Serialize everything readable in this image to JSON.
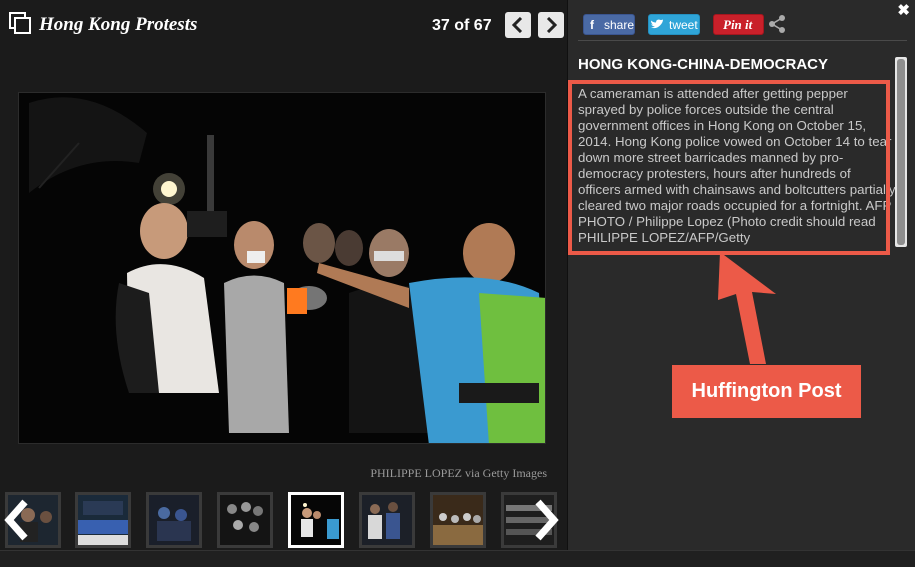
{
  "gallery": {
    "title": "Hong Kong Protests",
    "counter_text": "37 of 67",
    "current": 37,
    "total": 67,
    "photo_credit": "PHILIPPE LOPEZ via Getty Images",
    "prev_icon": "chevron-left-icon",
    "next_icon": "chevron-right-icon",
    "thumbnails": [
      {
        "alt": "thumbnail-1"
      },
      {
        "alt": "thumbnail-2"
      },
      {
        "alt": "thumbnail-3"
      },
      {
        "alt": "thumbnail-4"
      },
      {
        "alt": "thumbnail-5",
        "active": true
      },
      {
        "alt": "thumbnail-6"
      },
      {
        "alt": "thumbnail-7"
      },
      {
        "alt": "thumbnail-8"
      }
    ]
  },
  "share": {
    "facebook_label": "share",
    "twitter_label": "tweet",
    "pinterest_label": "Pin it"
  },
  "caption": {
    "title": "HONG KONG-CHINA-DEMOCRACY",
    "text": "A cameraman is attended after getting pepper sprayed by police forces outside the central government offices in Hong Kong on October 15, 2014. Hong Kong police vowed on October 14 to tear down more street barricades manned by pro-democracy protesters, hours after hundreds of officers armed with chainsaws and boltcutters partially cleared two major roads occupied for a fortnight. AFP PHOTO / Philippe Lopez (Photo credit should read PHILIPPE LOPEZ/AFP/Getty"
  },
  "annotation": {
    "label": "Huffington Post",
    "color": "#ec5a48"
  },
  "colors": {
    "facebook": "#4a6aa5",
    "twitter": "#2fa5d8",
    "pinterest": "#c9202a",
    "background": "#1b1b1b"
  }
}
